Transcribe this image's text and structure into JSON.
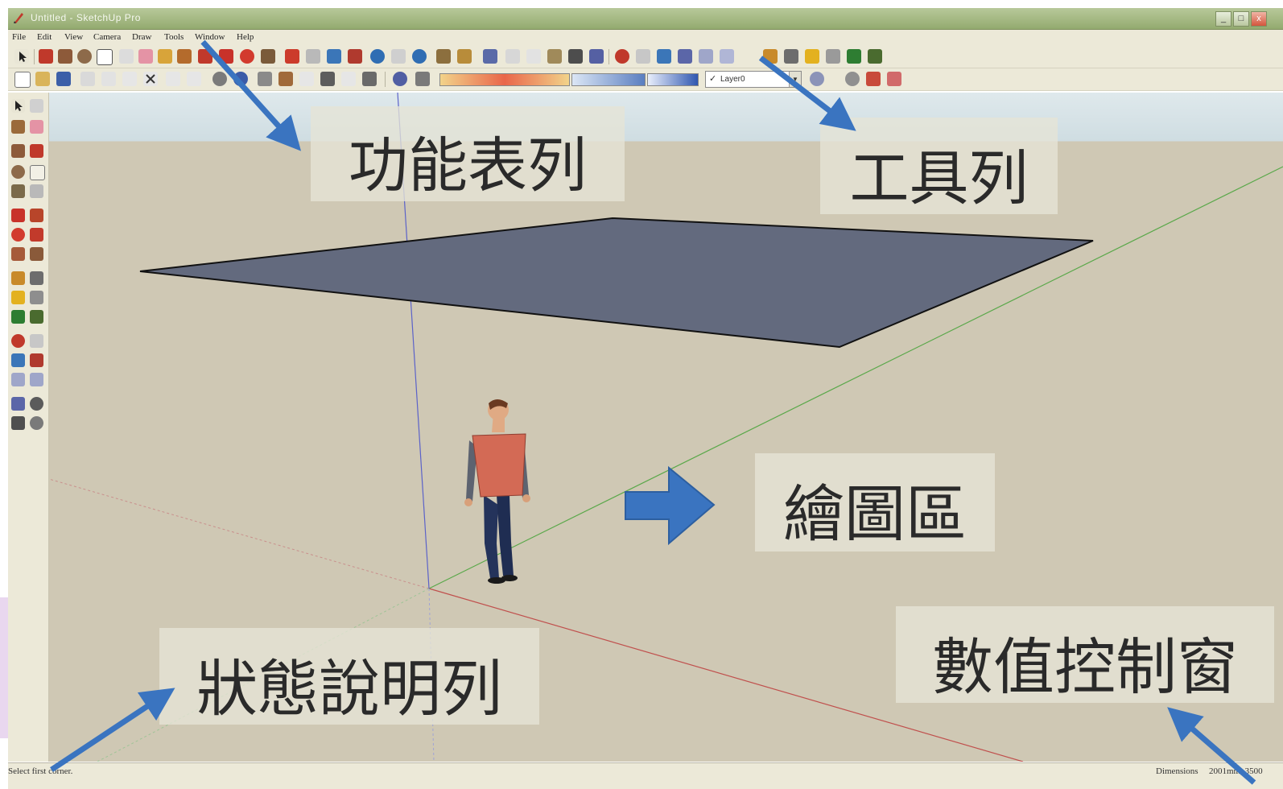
{
  "window": {
    "title": "Untitled - SketchUp Pro",
    "controls": {
      "minimize": "_",
      "maximize": "□",
      "close": "x"
    }
  },
  "menu": {
    "items": [
      "File",
      "Edit",
      "View",
      "Camera",
      "Draw",
      "Tools",
      "Window",
      "Help"
    ]
  },
  "toolbar": {
    "layer_checkmark": "✓",
    "layer_name": "Layer0"
  },
  "statusbar": {
    "prompt": "Select first corner.",
    "vcb_label": "Dimensions",
    "vcb_value": "2001mm, 3500"
  },
  "callouts": {
    "menu_bar": "功能表列",
    "toolbar": "工具列",
    "drawing_area": "繪圖區",
    "status_bar": "狀態說明列",
    "value_control_box": "數值控制窗"
  },
  "colors": {
    "callout_arrow": "#3a74c0",
    "rectangle_face": "#636a7e",
    "axis_red": "#c0504d",
    "axis_green": "#5aa84a",
    "axis_blue": "#5b62c9",
    "ground": "#cfc8b4",
    "sky": "#dde8ec"
  },
  "scene": {
    "figure": "person-figure"
  }
}
